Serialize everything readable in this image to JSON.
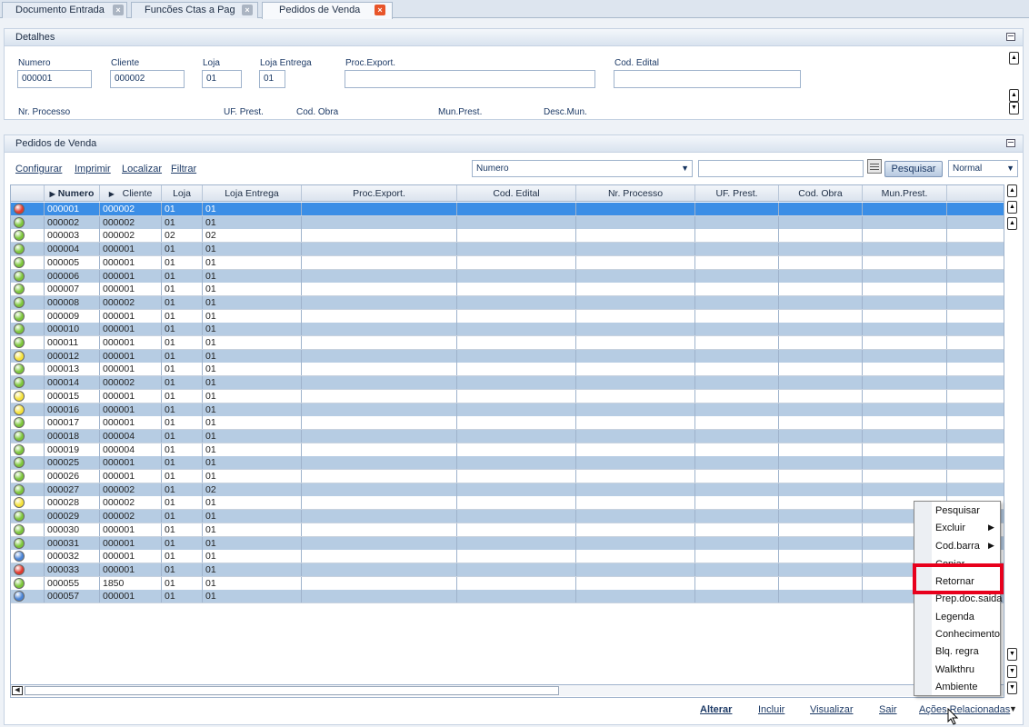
{
  "tabs": [
    {
      "label": "Documento Entrada"
    },
    {
      "label": "Funcões Ctas a Pag"
    },
    {
      "label": "Pedidos de Venda"
    }
  ],
  "detalhes": {
    "title": "Detalhes",
    "labels": {
      "numero": "Numero",
      "cliente": "Cliente",
      "loja": "Loja",
      "loja_entrega": "Loja Entrega",
      "proc_export": "Proc.Export.",
      "cod_edital": "Cod. Edital",
      "nr_processo": "Nr. Processo",
      "uf_prest": "UF. Prest.",
      "cod_obra": "Cod. Obra",
      "mun_prest": "Mun.Prest.",
      "desc_mun": "Desc.Mun."
    },
    "values": {
      "numero": "000001",
      "cliente": "000002",
      "loja": "01",
      "loja_entrega": "01",
      "proc_export": "",
      "cod_edital": ""
    }
  },
  "pedidos": {
    "title": "Pedidos de Venda",
    "toolbar": {
      "configurar": "Configurar",
      "imprimir": "Imprimir",
      "localizar": "Localizar",
      "filtrar": "Filtrar",
      "search_field": "Numero",
      "search_value": "",
      "pesquisar": "Pesquisar",
      "mode": "Normal"
    },
    "columns": [
      "Numero",
      "Cliente",
      "Loja",
      "Loja Entrega",
      "Proc.Export.",
      "Cod. Edital",
      "Nr. Processo",
      "UF. Prest.",
      "Cod. Obra",
      "Mun.Prest."
    ],
    "rows": [
      {
        "status": "red",
        "numero": "000001",
        "cliente": "000002",
        "loja": "01",
        "loja_entrega": "01",
        "selected": true
      },
      {
        "status": "green",
        "numero": "000002",
        "cliente": "000002",
        "loja": "01",
        "loja_entrega": "01"
      },
      {
        "status": "green",
        "numero": "000003",
        "cliente": "000002",
        "loja": "02",
        "loja_entrega": "02"
      },
      {
        "status": "green",
        "numero": "000004",
        "cliente": "000001",
        "loja": "01",
        "loja_entrega": "01"
      },
      {
        "status": "green",
        "numero": "000005",
        "cliente": "000001",
        "loja": "01",
        "loja_entrega": "01"
      },
      {
        "status": "green",
        "numero": "000006",
        "cliente": "000001",
        "loja": "01",
        "loja_entrega": "01"
      },
      {
        "status": "green",
        "numero": "000007",
        "cliente": "000001",
        "loja": "01",
        "loja_entrega": "01"
      },
      {
        "status": "green",
        "numero": "000008",
        "cliente": "000002",
        "loja": "01",
        "loja_entrega": "01"
      },
      {
        "status": "green",
        "numero": "000009",
        "cliente": "000001",
        "loja": "01",
        "loja_entrega": "01"
      },
      {
        "status": "green",
        "numero": "000010",
        "cliente": "000001",
        "loja": "01",
        "loja_entrega": "01"
      },
      {
        "status": "green",
        "numero": "000011",
        "cliente": "000001",
        "loja": "01",
        "loja_entrega": "01"
      },
      {
        "status": "yellow",
        "numero": "000012",
        "cliente": "000001",
        "loja": "01",
        "loja_entrega": "01"
      },
      {
        "status": "green",
        "numero": "000013",
        "cliente": "000001",
        "loja": "01",
        "loja_entrega": "01"
      },
      {
        "status": "green",
        "numero": "000014",
        "cliente": "000002",
        "loja": "01",
        "loja_entrega": "01"
      },
      {
        "status": "yellow",
        "numero": "000015",
        "cliente": "000001",
        "loja": "01",
        "loja_entrega": "01"
      },
      {
        "status": "yellow",
        "numero": "000016",
        "cliente": "000001",
        "loja": "01",
        "loja_entrega": "01"
      },
      {
        "status": "green",
        "numero": "000017",
        "cliente": "000001",
        "loja": "01",
        "loja_entrega": "01"
      },
      {
        "status": "green",
        "numero": "000018",
        "cliente": "000004",
        "loja": "01",
        "loja_entrega": "01"
      },
      {
        "status": "green",
        "numero": "000019",
        "cliente": "000004",
        "loja": "01",
        "loja_entrega": "01"
      },
      {
        "status": "green",
        "numero": "000025",
        "cliente": "000001",
        "loja": "01",
        "loja_entrega": "01"
      },
      {
        "status": "green",
        "numero": "000026",
        "cliente": "000001",
        "loja": "01",
        "loja_entrega": "01"
      },
      {
        "status": "green",
        "numero": "000027",
        "cliente": "000002",
        "loja": "01",
        "loja_entrega": "02"
      },
      {
        "status": "yellow",
        "numero": "000028",
        "cliente": "000002",
        "loja": "01",
        "loja_entrega": "01"
      },
      {
        "status": "green",
        "numero": "000029",
        "cliente": "000002",
        "loja": "01",
        "loja_entrega": "01"
      },
      {
        "status": "green",
        "numero": "000030",
        "cliente": "000001",
        "loja": "01",
        "loja_entrega": "01"
      },
      {
        "status": "green",
        "numero": "000031",
        "cliente": "000001",
        "loja": "01",
        "loja_entrega": "01"
      },
      {
        "status": "blue",
        "numero": "000032",
        "cliente": "000001",
        "loja": "01",
        "loja_entrega": "01"
      },
      {
        "status": "red",
        "numero": "000033",
        "cliente": "000001",
        "loja": "01",
        "loja_entrega": "01"
      },
      {
        "status": "green",
        "numero": "000055",
        "cliente": "1850",
        "loja": "01",
        "loja_entrega": "01"
      },
      {
        "status": "blue",
        "numero": "000057",
        "cliente": "000001",
        "loja": "01",
        "loja_entrega": "01"
      }
    ]
  },
  "context_menu": {
    "items": [
      {
        "label": "Pesquisar",
        "submenu": false
      },
      {
        "label": "Excluir",
        "submenu": true
      },
      {
        "label": "Cod.barra",
        "submenu": true
      },
      {
        "label": "Copiar",
        "submenu": false
      },
      {
        "label": "Retornar",
        "submenu": false,
        "highlighted": true
      },
      {
        "label": "Prep.doc.saida",
        "submenu": false
      },
      {
        "label": "Legenda",
        "submenu": false
      },
      {
        "label": "Conhecimento",
        "submenu": false
      },
      {
        "label": "Blq. regra",
        "submenu": false
      },
      {
        "label": "Walkthru",
        "submenu": false
      },
      {
        "label": "Ambiente",
        "submenu": false
      }
    ]
  },
  "bottom_bar": {
    "alterar": "Alterar",
    "incluir": "Incluir",
    "visualizar": "Visualizar",
    "sair": "Sair",
    "acoes": "Ações Relacionadas"
  },
  "colors": {
    "status_red": "#e23a2e",
    "status_green": "#7cc63a",
    "status_yellow": "#f5e23a",
    "status_blue": "#4a84d6",
    "selected_row": "#3b8ee6",
    "alt_row": "#b6cce3",
    "highlight": "#e8001c"
  }
}
